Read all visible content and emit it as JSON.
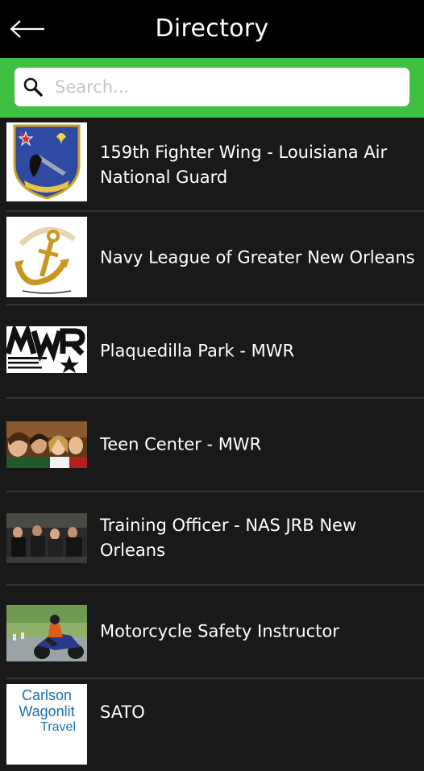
{
  "header": {
    "title": "Directory",
    "back_icon": "arrow-left-icon"
  },
  "search": {
    "placeholder": "Search...",
    "value": "",
    "icon": "search-icon"
  },
  "colors": {
    "header_bg": "#000000",
    "accent_green": "#3fc040",
    "list_bg": "#1a191a",
    "separator": "#333333"
  },
  "directory": {
    "items": [
      {
        "name": "159th Fighter Wing - Louisiana Air National Guard",
        "image": "159th-fighter-wing-emblem"
      },
      {
        "name": "Navy League of Greater New Orleans",
        "image": "navy-league-logo"
      },
      {
        "name": "Plaquedilla Park - MWR",
        "image": "mwr-logo"
      },
      {
        "name": "Teen Center - MWR",
        "image": "teen-center-photo"
      },
      {
        "name": "Training Officer - NAS JRB New Orleans",
        "image": "training-officer-photo"
      },
      {
        "name": "Motorcycle Safety Instructor",
        "image": "motorcycle-rider-photo"
      },
      {
        "name": "SATO",
        "image": "carlson-wagonlit-travel-logo",
        "logo_text": [
          "Carlson",
          "Wagonlit",
          "Travel"
        ]
      }
    ]
  }
}
